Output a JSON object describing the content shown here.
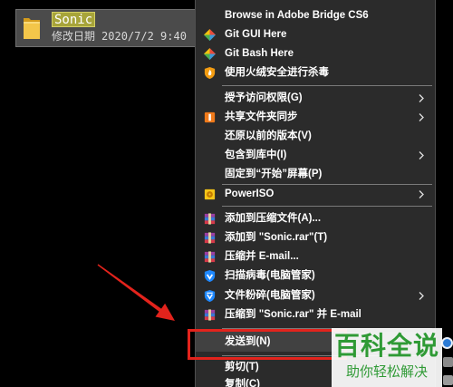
{
  "file_item": {
    "name": "Sonic",
    "date_label": "修改日期",
    "date_value": "2020/7/2 9:40",
    "icon": "folder-icon"
  },
  "context_menu": {
    "items": [
      {
        "label": "Browse in Adobe Bridge CS6"
      },
      {
        "label": "Git GUI Here",
        "icon": "git-gui-icon"
      },
      {
        "label": "Git Bash Here",
        "icon": "git-bash-icon"
      },
      {
        "label": "使用火绒安全进行杀毒",
        "icon": "huorong-shield-icon"
      },
      {
        "label": "授予访问权限(G)",
        "submenu": true
      },
      {
        "label": "共享文件夹同步",
        "icon": "folder-sync-icon",
        "submenu": true
      },
      {
        "label": "还原以前的版本(V)"
      },
      {
        "label": "包含到库中(I)",
        "submenu": true
      },
      {
        "label": "固定到“开始”屏幕(P)"
      },
      {
        "label": "PowerISO",
        "icon": "poweriso-icon",
        "submenu": true
      },
      {
        "label": "添加到压缩文件(A)...",
        "icon": "winrar-icon"
      },
      {
        "label": "添加到 \"Sonic.rar\"(T)",
        "icon": "winrar-icon"
      },
      {
        "label": "压缩并 E-mail...",
        "icon": "winrar-icon"
      },
      {
        "label": "扫描病毒(电脑管家)",
        "icon": "pc-manager-scan-icon"
      },
      {
        "label": "文件粉碎(电脑管家)",
        "icon": "pc-manager-shred-icon",
        "submenu": true
      },
      {
        "label": "压缩到 \"Sonic.rar\" 并 E-mail",
        "icon": "winrar-icon"
      },
      {
        "label": "发送到(N)",
        "submenu": true,
        "highlighted": true
      },
      {
        "label": "剪切(T)"
      },
      {
        "label": "复制(C)"
      }
    ]
  },
  "watermark": {
    "title": "百科全说",
    "subtitle": "助你轻松解决"
  },
  "colors": {
    "background": "#000000",
    "menu_background": "#2b2b2b",
    "menu_text": "#ffffff",
    "menu_highlight": "#414141",
    "menu_separator": "#7a7a7a",
    "file_row_background": "#4b4b4b",
    "search_highlight": "#a7a43a",
    "annotation_red": "#e3231c",
    "watermark_green": "#2f9a35"
  }
}
